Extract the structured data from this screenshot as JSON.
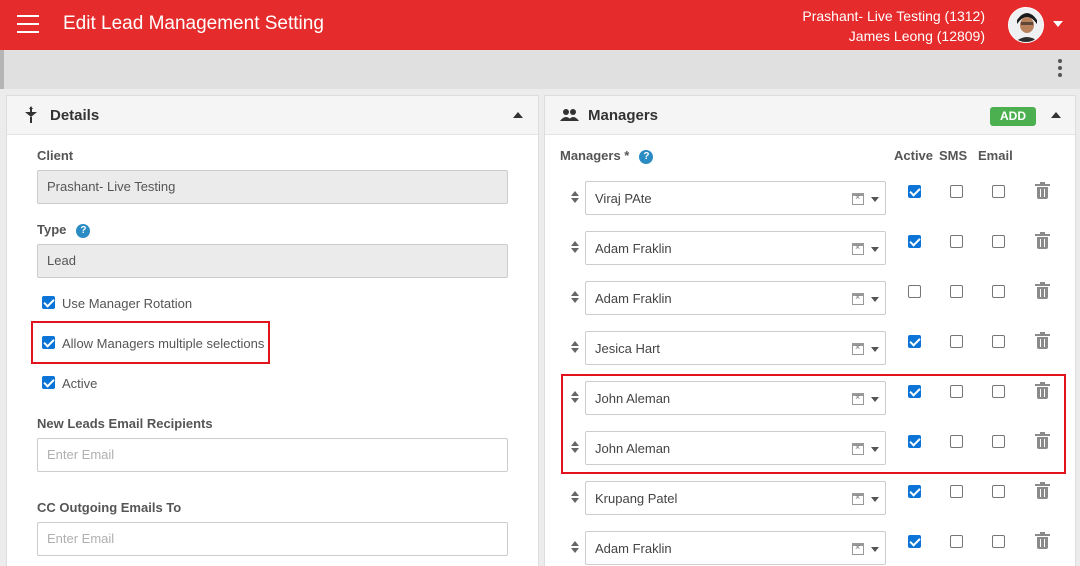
{
  "header": {
    "title": "Edit Lead Management Setting",
    "account_line": "Prashant- Live Testing (1312)",
    "user_line": "James Leong (12809)"
  },
  "details": {
    "title": "Details",
    "client_label": "Client",
    "client_value": "Prashant- Live Testing",
    "type_label": "Type",
    "type_value": "Lead",
    "help_glyph": "?",
    "use_rotation_label": "Use Manager Rotation",
    "use_rotation_checked": true,
    "allow_multiple_label": "Allow Managers multiple selections",
    "allow_multiple_checked": true,
    "active_label": "Active",
    "active_checked": true,
    "new_leads_label": "New Leads Email Recipients",
    "new_leads_placeholder": "Enter Email",
    "cc_label": "CC Outgoing Emails To",
    "cc_placeholder": "Enter Email"
  },
  "managers": {
    "title": "Managers",
    "add_label": "ADD",
    "list_label": "Managers *",
    "col_active": "Active",
    "col_sms": "SMS",
    "col_email": "Email",
    "rows": [
      {
        "name": "Viraj PAte",
        "active": true,
        "sms": false,
        "email": false
      },
      {
        "name": "Adam Fraklin",
        "active": true,
        "sms": false,
        "email": false
      },
      {
        "name": "Adam Fraklin",
        "active": false,
        "sms": false,
        "email": false
      },
      {
        "name": "Jesica Hart",
        "active": true,
        "sms": false,
        "email": false
      },
      {
        "name": "John Aleman",
        "active": true,
        "sms": false,
        "email": false
      },
      {
        "name": "John Aleman",
        "active": true,
        "sms": false,
        "email": false
      },
      {
        "name": "Krupang Patel",
        "active": true,
        "sms": false,
        "email": false
      },
      {
        "name": "Adam Fraklin",
        "active": true,
        "sms": false,
        "email": false
      }
    ]
  },
  "colors": {
    "topbar": "#e52b2b",
    "checkbox": "#0b74d6",
    "add_button": "#4cb050",
    "highlight": "#e1141e"
  }
}
